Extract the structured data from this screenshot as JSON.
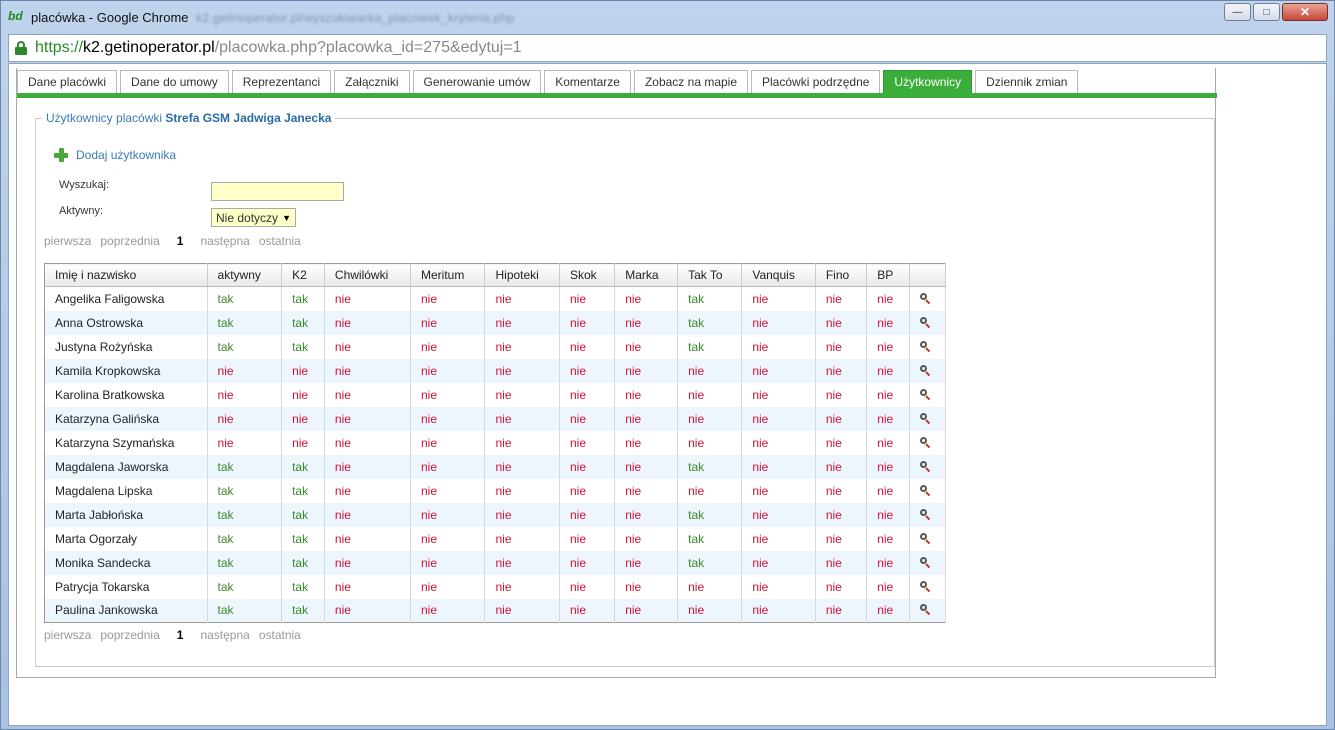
{
  "window": {
    "app_badge": "bd",
    "title": "placówka - Google Chrome",
    "blurred_title": "k2.getinoperator.pl/wyszukiwarka_placowek_kryteria.php"
  },
  "address": {
    "scheme": "https://",
    "host": "k2.getinoperator.pl",
    "path": "/placowka.php?placowka_id=275&edytuj=1"
  },
  "tabs": [
    {
      "label": "Dane placówki",
      "active": false
    },
    {
      "label": "Dane do umowy",
      "active": false
    },
    {
      "label": "Reprezentanci",
      "active": false
    },
    {
      "label": "Załączniki",
      "active": false
    },
    {
      "label": "Generowanie umów",
      "active": false
    },
    {
      "label": "Komentarze",
      "active": false
    },
    {
      "label": "Zobacz na mapie",
      "active": false
    },
    {
      "label": "Placówki podrzędne",
      "active": false
    },
    {
      "label": "Użytkownicy",
      "active": true
    },
    {
      "label": "Dziennik zmian",
      "active": false
    }
  ],
  "section": {
    "legend_prefix": "Użytkownicy placówki ",
    "legend_name": "Strefa GSM Jadwiga Janecka",
    "add_user_label": "Dodaj użytkownika"
  },
  "filters": {
    "search_label": "Wyszukaj:",
    "search_value": "",
    "active_label": "Aktywny:",
    "active_value": "Nie dotyczy"
  },
  "pager": {
    "first": "pierwsza",
    "prev": "poprzednia",
    "current": "1",
    "next": "następna",
    "last": "ostatnia"
  },
  "table": {
    "headers": [
      "Imię i nazwisko",
      "aktywny",
      "K2",
      "Chwilówki",
      "Meritum",
      "Hipoteki",
      "Skok",
      "Marka",
      "Tak To",
      "Vanquis",
      "Fino",
      "BP",
      ""
    ],
    "rows": [
      {
        "name": "Angelika Faligowska",
        "values": [
          "tak",
          "tak",
          "nie",
          "nie",
          "nie",
          "nie",
          "nie",
          "tak",
          "nie",
          "nie",
          "nie"
        ]
      },
      {
        "name": "Anna Ostrowska",
        "values": [
          "tak",
          "tak",
          "nie",
          "nie",
          "nie",
          "nie",
          "nie",
          "tak",
          "nie",
          "nie",
          "nie"
        ]
      },
      {
        "name": "Justyna Rożyńska",
        "values": [
          "tak",
          "tak",
          "nie",
          "nie",
          "nie",
          "nie",
          "nie",
          "tak",
          "nie",
          "nie",
          "nie"
        ]
      },
      {
        "name": "Kamila Kropkowska",
        "values": [
          "nie",
          "nie",
          "nie",
          "nie",
          "nie",
          "nie",
          "nie",
          "nie",
          "nie",
          "nie",
          "nie"
        ]
      },
      {
        "name": "Karolina Bratkowska",
        "values": [
          "nie",
          "nie",
          "nie",
          "nie",
          "nie",
          "nie",
          "nie",
          "nie",
          "nie",
          "nie",
          "nie"
        ]
      },
      {
        "name": "Katarzyna Galińska",
        "values": [
          "nie",
          "nie",
          "nie",
          "nie",
          "nie",
          "nie",
          "nie",
          "nie",
          "nie",
          "nie",
          "nie"
        ]
      },
      {
        "name": "Katarzyna Szymańska",
        "values": [
          "nie",
          "nie",
          "nie",
          "nie",
          "nie",
          "nie",
          "nie",
          "nie",
          "nie",
          "nie",
          "nie"
        ]
      },
      {
        "name": "Magdalena Jaworska",
        "values": [
          "tak",
          "tak",
          "nie",
          "nie",
          "nie",
          "nie",
          "nie",
          "tak",
          "nie",
          "nie",
          "nie"
        ]
      },
      {
        "name": "Magdalena Lipska",
        "values": [
          "tak",
          "tak",
          "nie",
          "nie",
          "nie",
          "nie",
          "nie",
          "nie",
          "nie",
          "nie",
          "nie"
        ]
      },
      {
        "name": "Marta Jabłońska",
        "values": [
          "tak",
          "tak",
          "nie",
          "nie",
          "nie",
          "nie",
          "nie",
          "tak",
          "nie",
          "nie",
          "nie"
        ]
      },
      {
        "name": "Marta Ogorzały",
        "values": [
          "tak",
          "tak",
          "nie",
          "nie",
          "nie",
          "nie",
          "nie",
          "tak",
          "nie",
          "nie",
          "nie"
        ]
      },
      {
        "name": "Monika Sandecka",
        "values": [
          "tak",
          "tak",
          "nie",
          "nie",
          "nie",
          "nie",
          "nie",
          "tak",
          "nie",
          "nie",
          "nie"
        ]
      },
      {
        "name": "Patrycja Tokarska",
        "values": [
          "tak",
          "tak",
          "nie",
          "nie",
          "nie",
          "nie",
          "nie",
          "nie",
          "nie",
          "nie",
          "nie"
        ]
      },
      {
        "name": "Paulina Jankowska",
        "values": [
          "tak",
          "tak",
          "nie",
          "nie",
          "nie",
          "nie",
          "nie",
          "nie",
          "nie",
          "nie",
          "nie"
        ]
      }
    ],
    "row_action_icon": "magnifier-icon"
  },
  "colors": {
    "accent_green": "#3aad3a",
    "yes": "#3a8a2a",
    "no": "#cc1133",
    "link_blue": "#3b7ab8",
    "input_yellow": "#ffffc8"
  }
}
